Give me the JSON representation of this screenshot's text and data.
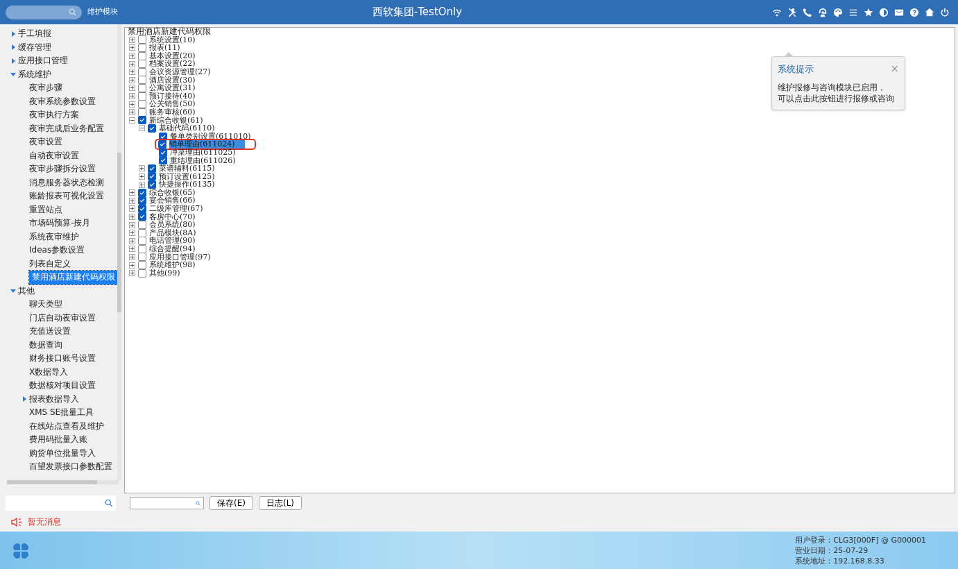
{
  "topbar": {
    "module": "维护模块",
    "title": "西软集团-TestOnly"
  },
  "sidebar": {
    "items": [
      {
        "label": "手工填报",
        "expanded": false,
        "selected": false
      },
      {
        "label": "缓存管理",
        "expanded": false,
        "selected": false
      },
      {
        "label": "应用接口管理",
        "expanded": false,
        "selected": false
      },
      {
        "label": "系统维护",
        "expanded": true,
        "selected": false,
        "children": [
          {
            "label": "夜审步骤",
            "selected": false
          },
          {
            "label": "夜审系统参数设置",
            "selected": false
          },
          {
            "label": "夜审执行方案",
            "selected": false
          },
          {
            "label": "夜审完成后业务配置",
            "selected": false
          },
          {
            "label": "夜审设置",
            "selected": false
          },
          {
            "label": "自动夜审设置",
            "selected": false
          },
          {
            "label": "夜审步骤拆分设置",
            "selected": false
          },
          {
            "label": "消息服务器状态检测",
            "selected": false
          },
          {
            "label": "账龄报表可视化设置",
            "selected": false
          },
          {
            "label": "重置站点",
            "selected": false
          },
          {
            "label": "市场码预算-按月",
            "selected": false
          },
          {
            "label": "系统夜审维护",
            "selected": false
          },
          {
            "label": "Ideas参数设置",
            "selected": false
          },
          {
            "label": "列表自定义",
            "selected": false
          },
          {
            "label": "禁用酒店新建代码权限",
            "selected": true
          }
        ]
      },
      {
        "label": "其他",
        "expanded": true,
        "selected": false,
        "children": [
          {
            "label": "聊天类型",
            "selected": false
          },
          {
            "label": "门店自动夜审设置",
            "selected": false
          },
          {
            "label": "充值送设置",
            "selected": false
          },
          {
            "label": "数据查询",
            "selected": false
          },
          {
            "label": "财务接口账号设置",
            "selected": false
          },
          {
            "label": "X数据导入",
            "selected": false
          },
          {
            "label": "数据核对项目设置",
            "selected": false
          },
          {
            "label": "报表数据导入",
            "expanded": false,
            "selected": false
          },
          {
            "label": "XMS SE批量工具",
            "selected": false
          },
          {
            "label": "在线站点查看及维护",
            "selected": false
          },
          {
            "label": "费用码批量入账",
            "selected": false
          },
          {
            "label": "购货单位批量导入",
            "selected": false
          },
          {
            "label": "百望发票接口参数配置",
            "selected": false
          }
        ]
      }
    ]
  },
  "tree": {
    "title": "禁用酒店新建代码权限",
    "nodes": [
      {
        "label": "系统设置(10)",
        "checked": false,
        "expanded": false
      },
      {
        "label": "报表(11)",
        "checked": false,
        "expanded": false
      },
      {
        "label": "基本设置(20)",
        "checked": false,
        "expanded": false
      },
      {
        "label": "档案设置(22)",
        "checked": false,
        "expanded": false
      },
      {
        "label": "会议资源管理(27)",
        "checked": false,
        "expanded": false
      },
      {
        "label": "酒店设置(30)",
        "checked": false,
        "expanded": false
      },
      {
        "label": "公寓设置(31)",
        "checked": false,
        "expanded": false
      },
      {
        "label": "预订接待(40)",
        "checked": false,
        "expanded": false
      },
      {
        "label": "公关销售(50)",
        "checked": false,
        "expanded": false
      },
      {
        "label": "账务审核(60)",
        "checked": false,
        "expanded": false
      },
      {
        "label": "新综合收银(61)",
        "checked": true,
        "expanded": true,
        "children": [
          {
            "label": "基础代码(6110)",
            "checked": true,
            "expanded": true,
            "children": [
              {
                "label": "餐单类别设置(611010)",
                "checked": true,
                "selected": false,
                "outlined": false
              },
              {
                "label": "销单理由(611024)",
                "checked": true,
                "selected": true,
                "outlined": true
              },
              {
                "label": "冲菜理由(611025)",
                "checked": true,
                "selected": false,
                "outlined": false
              },
              {
                "label": "重结理由(611026)",
                "checked": true,
                "selected": false,
                "outlined": false
              }
            ]
          },
          {
            "label": "菜谱辅料(6115)",
            "checked": true,
            "expanded": false
          },
          {
            "label": "预订设置(6125)",
            "checked": true,
            "expanded": false
          },
          {
            "label": "快捷操作(6135)",
            "checked": true,
            "expanded": false
          }
        ]
      },
      {
        "label": "综合收银(65)",
        "checked": true,
        "expanded": false
      },
      {
        "label": "宴会销售(66)",
        "checked": true,
        "expanded": false
      },
      {
        "label": "二级库管理(67)",
        "checked": true,
        "expanded": false
      },
      {
        "label": "客房中心(70)",
        "checked": true,
        "expanded": false
      },
      {
        "label": "会员系统(80)",
        "checked": false,
        "expanded": false
      },
      {
        "label": "产品模块(8A)",
        "checked": false,
        "expanded": false
      },
      {
        "label": "电话管理(90)",
        "checked": false,
        "expanded": false
      },
      {
        "label": "综合提醒(94)",
        "checked": false,
        "expanded": false
      },
      {
        "label": "应用接口管理(97)",
        "checked": false,
        "expanded": false
      },
      {
        "label": "系统维护(98)",
        "checked": false,
        "expanded": false
      },
      {
        "label": "其他(99)",
        "checked": false,
        "expanded": false
      }
    ]
  },
  "popover": {
    "title": "系统提示",
    "close": "×",
    "lines": [
      "维护报修与咨询模块已启用，",
      "可以点击此按钮进行报修或咨询"
    ]
  },
  "footer": {
    "buttons": [
      "保存(E)",
      "日志(L)"
    ]
  },
  "status": {
    "message": "暂无消息"
  },
  "taskbar": {
    "info": [
      "用户登录：CLG3[000F] @ G000001",
      "营业日期：25-07-29",
      "系统地址：192.168.8.33"
    ]
  }
}
